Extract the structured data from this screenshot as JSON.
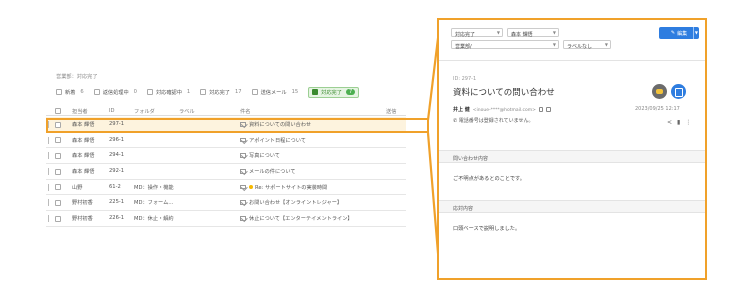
{
  "list": {
    "section_label": "営業部：対応完了",
    "filters": [
      {
        "label": "新着",
        "count": "6"
      },
      {
        "label": "返信処理中",
        "count": "0"
      },
      {
        "label": "対応確認中",
        "count": "1"
      },
      {
        "label": "対応完了",
        "count": "17"
      },
      {
        "label": "送信メール",
        "count": "15"
      }
    ],
    "active_filter": {
      "label": "対応完了",
      "count": "7"
    },
    "columns": {
      "assignee": "担当者",
      "id": "ID",
      "folder": "フォルダ",
      "label": "ラベル",
      "subject": "件名",
      "more": "送信"
    },
    "rows": [
      {
        "assignee": "森本 輝悟",
        "id": "297-1",
        "folder": "",
        "subject": "資料についての問い合わせ",
        "selected": true,
        "has_dot": false
      },
      {
        "assignee": "森本 輝悟",
        "id": "296-1",
        "folder": "",
        "subject": "アポイント日程について",
        "selected": false,
        "has_dot": false
      },
      {
        "assignee": "森本 輝悟",
        "id": "294-1",
        "folder": "",
        "subject": "写真について",
        "selected": false,
        "has_dot": false
      },
      {
        "assignee": "森本 輝悟",
        "id": "292-1",
        "folder": "",
        "subject": "メールの件について",
        "selected": false,
        "has_dot": false
      },
      {
        "assignee": "山野",
        "id": "61-2",
        "folder": "MD：操作・機能",
        "subject": "Re: サポートサイトの実装時間",
        "selected": false,
        "has_dot": true
      },
      {
        "assignee": "野村初香",
        "id": "225-1",
        "folder": "MD：フォーム…",
        "subject": "お問い合わせ【オンライントレジャー】",
        "selected": false,
        "has_dot": false
      },
      {
        "assignee": "野村初香",
        "id": "226-1",
        "folder": "MD：休止・解約",
        "subject": "休止について【エンターテイメントライン】",
        "selected": false,
        "has_dot": false
      }
    ]
  },
  "detail": {
    "status_select": "対応完了",
    "assignee_select": "森本 輝悟",
    "folder_select": "営業部/",
    "label_select": "ラベルなし",
    "edit_label": "編集",
    "id_text": "ID: 297-1",
    "subject": "資料についての問い合わせ",
    "from_name": "井上 健",
    "from_email": "<inoue-****@hotmail.com>",
    "date": "2023/09/25 12:17",
    "phone_note": "電話番号は登録されていません。",
    "section1_title": "問い合わせ内容",
    "section1_body": "ご不明点があるとのことです。",
    "section2_title": "応対内容",
    "section2_body": "口頭ベースで説明しました。"
  },
  "colors": {
    "highlight": "#f0a12a",
    "accent_blue": "#2e7de0",
    "active_green": "#4caf50"
  }
}
